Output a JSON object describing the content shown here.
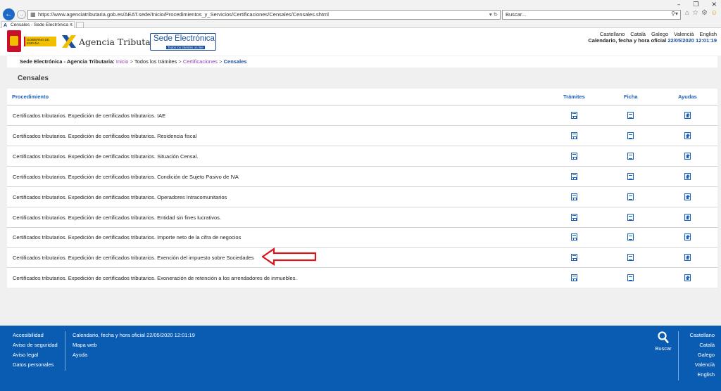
{
  "browser": {
    "url": "https://www.agenciatributaria.gob.es/AEAT.sede/Inicio/Procedimientos_y_Servicios/Certificaciones/Censales/Censales.shtml",
    "search_placeholder": "Buscar...",
    "tab_title": "Censales - Sede Electrónica ..."
  },
  "header": {
    "gov_text": "GOBIERNO DE ESPAÑA",
    "agency_name": "Agencia Tributaria",
    "sede_title": "Sede Electrónica",
    "sede_subtitle": "Todos los trámites on line",
    "languages": [
      "Castellano",
      "Català",
      "Galego",
      "Valencià",
      "English"
    ],
    "datetime_label": "Calendario, fecha y hora oficial",
    "datetime_value": "22/05/2020 12:01:19"
  },
  "breadcrumb": {
    "site": "Sede Electrónica - Agencia Tributaria:",
    "inicio": "Inicio",
    "sep": ">",
    "todos": "Todos los trámites",
    "certificaciones": "Certificaciones",
    "current": "Censales"
  },
  "page": {
    "title": "Censales"
  },
  "table": {
    "headers": {
      "procedimiento": "Procedimiento",
      "tramites": "Trámites",
      "ficha": "Ficha",
      "ayudas": "Ayudas"
    },
    "rows": [
      "Certificados tributarios. Expedición de certificados tributarios. IAE",
      "Certificados tributarios. Expedición de certificados tributarios. Residencia fiscal",
      "Certificados tributarios. Expedición de certificados tributarios. Situación Censal.",
      "Certificados tributarios. Expedición de certificados tributarios. Condición de Sujeto Pasivo de IVA",
      "Certificados tributarios. Expedición de certificados tributarios. Operadores Intracomunitarios",
      "Certificados tributarios. Expedición de certificados tributarios. Entidad sin fines lucrativos.",
      "Certificados tributarios. Expedición de certificados tributarios. Importe neto de la cifra de negocios",
      "Certificados tributarios. Expedición de certificados tributarios. Exención del impuesto sobre Sociedades",
      "Certificados tributarios. Expedición de certificados tributarios. Exoneración de retención a los arrendadores de inmuebles."
    ]
  },
  "footer": {
    "col1": [
      "Accesibilidad",
      "Aviso de seguridad",
      "Aviso legal",
      "Datos personales"
    ],
    "col2": [
      "Calendario, fecha y hora oficial 22/05/2020 12:01:19",
      "Mapa web",
      "Ayuda"
    ],
    "search_label": "Buscar",
    "languages": [
      "Castellano",
      "Català",
      "Galego",
      "Valencià",
      "English"
    ]
  },
  "colors": {
    "accent": "#1c5fb8",
    "footer_bg": "#0a5cb3",
    "annotation_arrow": "#d9141b"
  }
}
